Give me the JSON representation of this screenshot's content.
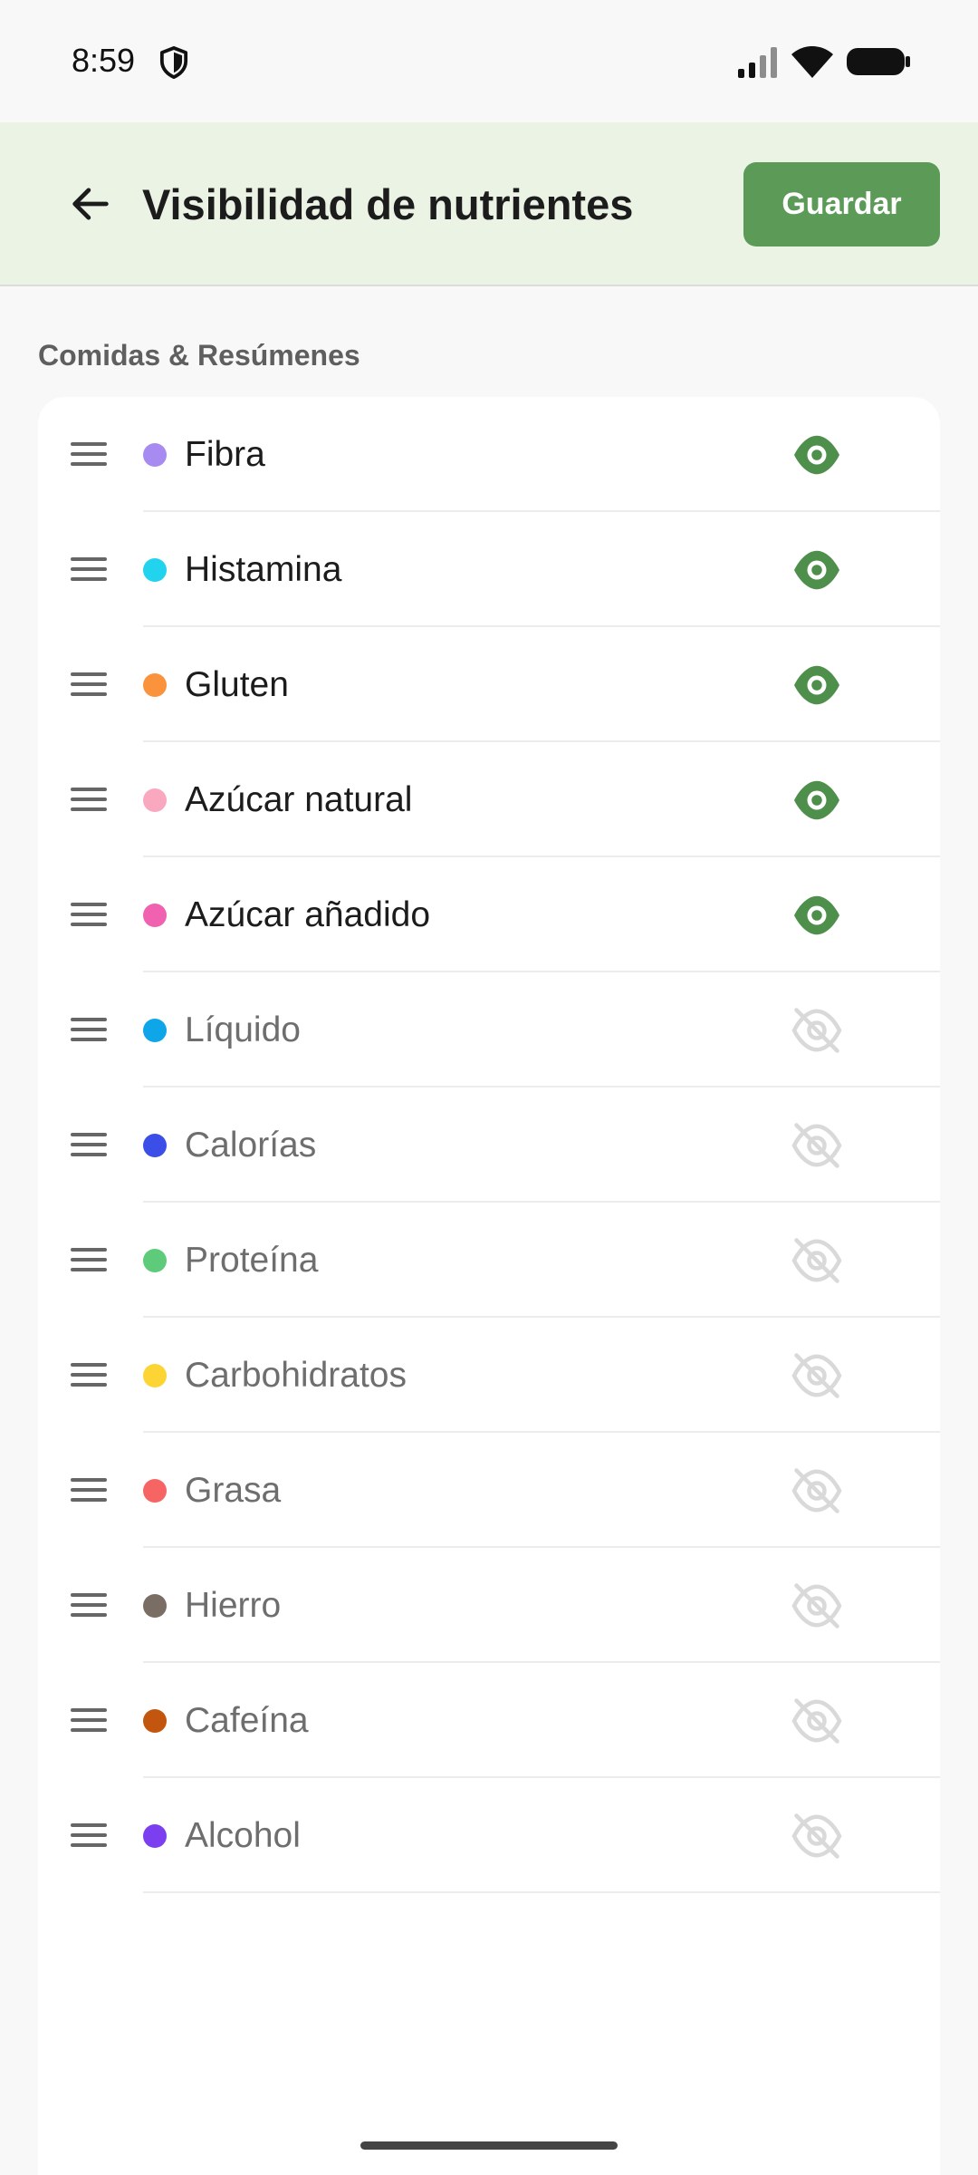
{
  "status_bar": {
    "time": "8:59"
  },
  "app_bar": {
    "title": "Visibilidad de nutrientes",
    "save_label": "Guardar"
  },
  "section": {
    "title": "Comidas & Resúmenes",
    "items": [
      {
        "label": "Fibra",
        "color": "#a78bf0",
        "visible": true
      },
      {
        "label": "Histamina",
        "color": "#22d3ee",
        "visible": true
      },
      {
        "label": "Gluten",
        "color": "#fb923c",
        "visible": true
      },
      {
        "label": "Azúcar natural",
        "color": "#f9a8c0",
        "visible": true
      },
      {
        "label": "Azúcar añadido",
        "color": "#f062b0",
        "visible": true
      },
      {
        "label": "Líquido",
        "color": "#0ea5e9",
        "visible": false
      },
      {
        "label": "Calorías",
        "color": "#3b4ee8",
        "visible": false
      },
      {
        "label": "Proteína",
        "color": "#5ecb7a",
        "visible": false
      },
      {
        "label": "Carbohidratos",
        "color": "#fcd535",
        "visible": false
      },
      {
        "label": "Grasa",
        "color": "#f76464",
        "visible": false
      },
      {
        "label": "Hierro",
        "color": "#7a6e64",
        "visible": false
      },
      {
        "label": "Cafeína",
        "color": "#c2560f",
        "visible": false
      },
      {
        "label": "Alcohol",
        "color": "#7b3ff0",
        "visible": false
      }
    ]
  },
  "colors": {
    "accent": "#5b9b57",
    "app_bar_bg": "#ebf3e4",
    "eye_visible": "#4f8f4c",
    "eye_hidden": "#d9d9d9"
  },
  "icons": {
    "back": "arrow-left-icon",
    "drag": "drag-handle-icon",
    "visible": "eye-icon",
    "hidden": "eye-off-icon"
  }
}
